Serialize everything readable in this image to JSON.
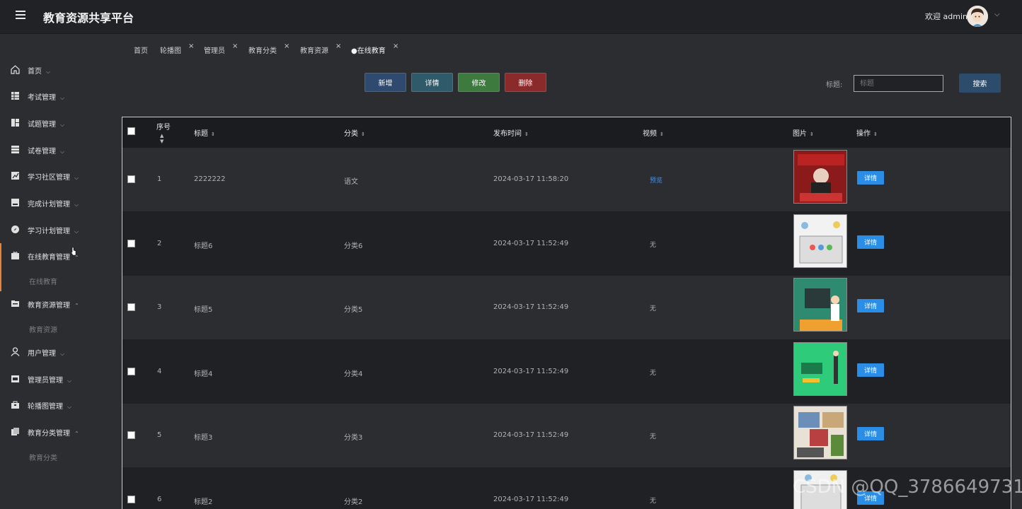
{
  "header": {
    "title": "教育资源共享平台",
    "welcome": "欢迎 admin"
  },
  "sidebar": {
    "items": [
      {
        "label": "首页",
        "icon": "home-icon"
      },
      {
        "label": "考试管理",
        "icon": "grid-icon"
      },
      {
        "label": "试题管理",
        "icon": "layout-icon"
      },
      {
        "label": "试卷管理",
        "icon": "list-icon"
      },
      {
        "label": "学习社区管理",
        "icon": "chart-icon"
      },
      {
        "label": "完成计划管理",
        "icon": "doc-icon"
      },
      {
        "label": "学习计划管理",
        "icon": "compass-icon"
      },
      {
        "label": "在线教育管理",
        "icon": "gift-icon",
        "sub": "在线教育"
      },
      {
        "label": "教育资源管理",
        "icon": "folder-icon",
        "sub": "教育资源"
      },
      {
        "label": "用户管理",
        "icon": "user-icon"
      },
      {
        "label": "管理员管理",
        "icon": "store-icon"
      },
      {
        "label": "轮播图管理",
        "icon": "bag-icon"
      },
      {
        "label": "教育分类管理",
        "icon": "tags-icon",
        "sub": "教育分类"
      }
    ]
  },
  "tabs": [
    "首页",
    "轮播图",
    "管理员",
    "教育分类",
    "教育资源",
    "●在线教育"
  ],
  "toolbar": {
    "add": "新增",
    "detail": "详情",
    "edit": "修改",
    "delete": "删除",
    "search_label": "标题:",
    "search_placeholder": "标题",
    "search_button": "搜索"
  },
  "table": {
    "headers": {
      "index": "序号",
      "title": "标题",
      "category": "分类",
      "time": "发布时间",
      "video": "视频",
      "image": "图片",
      "action": "操作"
    },
    "rows": [
      {
        "index": "1",
        "title": "2222222",
        "category": "语文",
        "time": "2024-03-17 11:58:20",
        "video": "预览",
        "action": "详情"
      },
      {
        "index": "2",
        "title": "标题6",
        "category": "分类6",
        "time": "2024-03-17 11:52:49",
        "video": "无",
        "action": "详情"
      },
      {
        "index": "3",
        "title": "标题5",
        "category": "分类5",
        "time": "2024-03-17 11:52:49",
        "video": "无",
        "action": "详情"
      },
      {
        "index": "4",
        "title": "标题4",
        "category": "分类4",
        "time": "2024-03-17 11:52:49",
        "video": "无",
        "action": "详情"
      },
      {
        "index": "5",
        "title": "标题3",
        "category": "分类3",
        "time": "2024-03-17 11:52:49",
        "video": "无",
        "action": "详情"
      },
      {
        "index": "6",
        "title": "标题2",
        "category": "分类2",
        "time": "2024-03-17 11:52:49",
        "video": "无",
        "action": "详情"
      }
    ]
  },
  "thumb_colors": [
    "#8b1a1a",
    "#f2f2f2",
    "#2e8b6f",
    "#2ecc7a",
    "#e8e2d6",
    "#f0f0f0"
  ],
  "watermark": "CSDN @QQ_3786649731"
}
